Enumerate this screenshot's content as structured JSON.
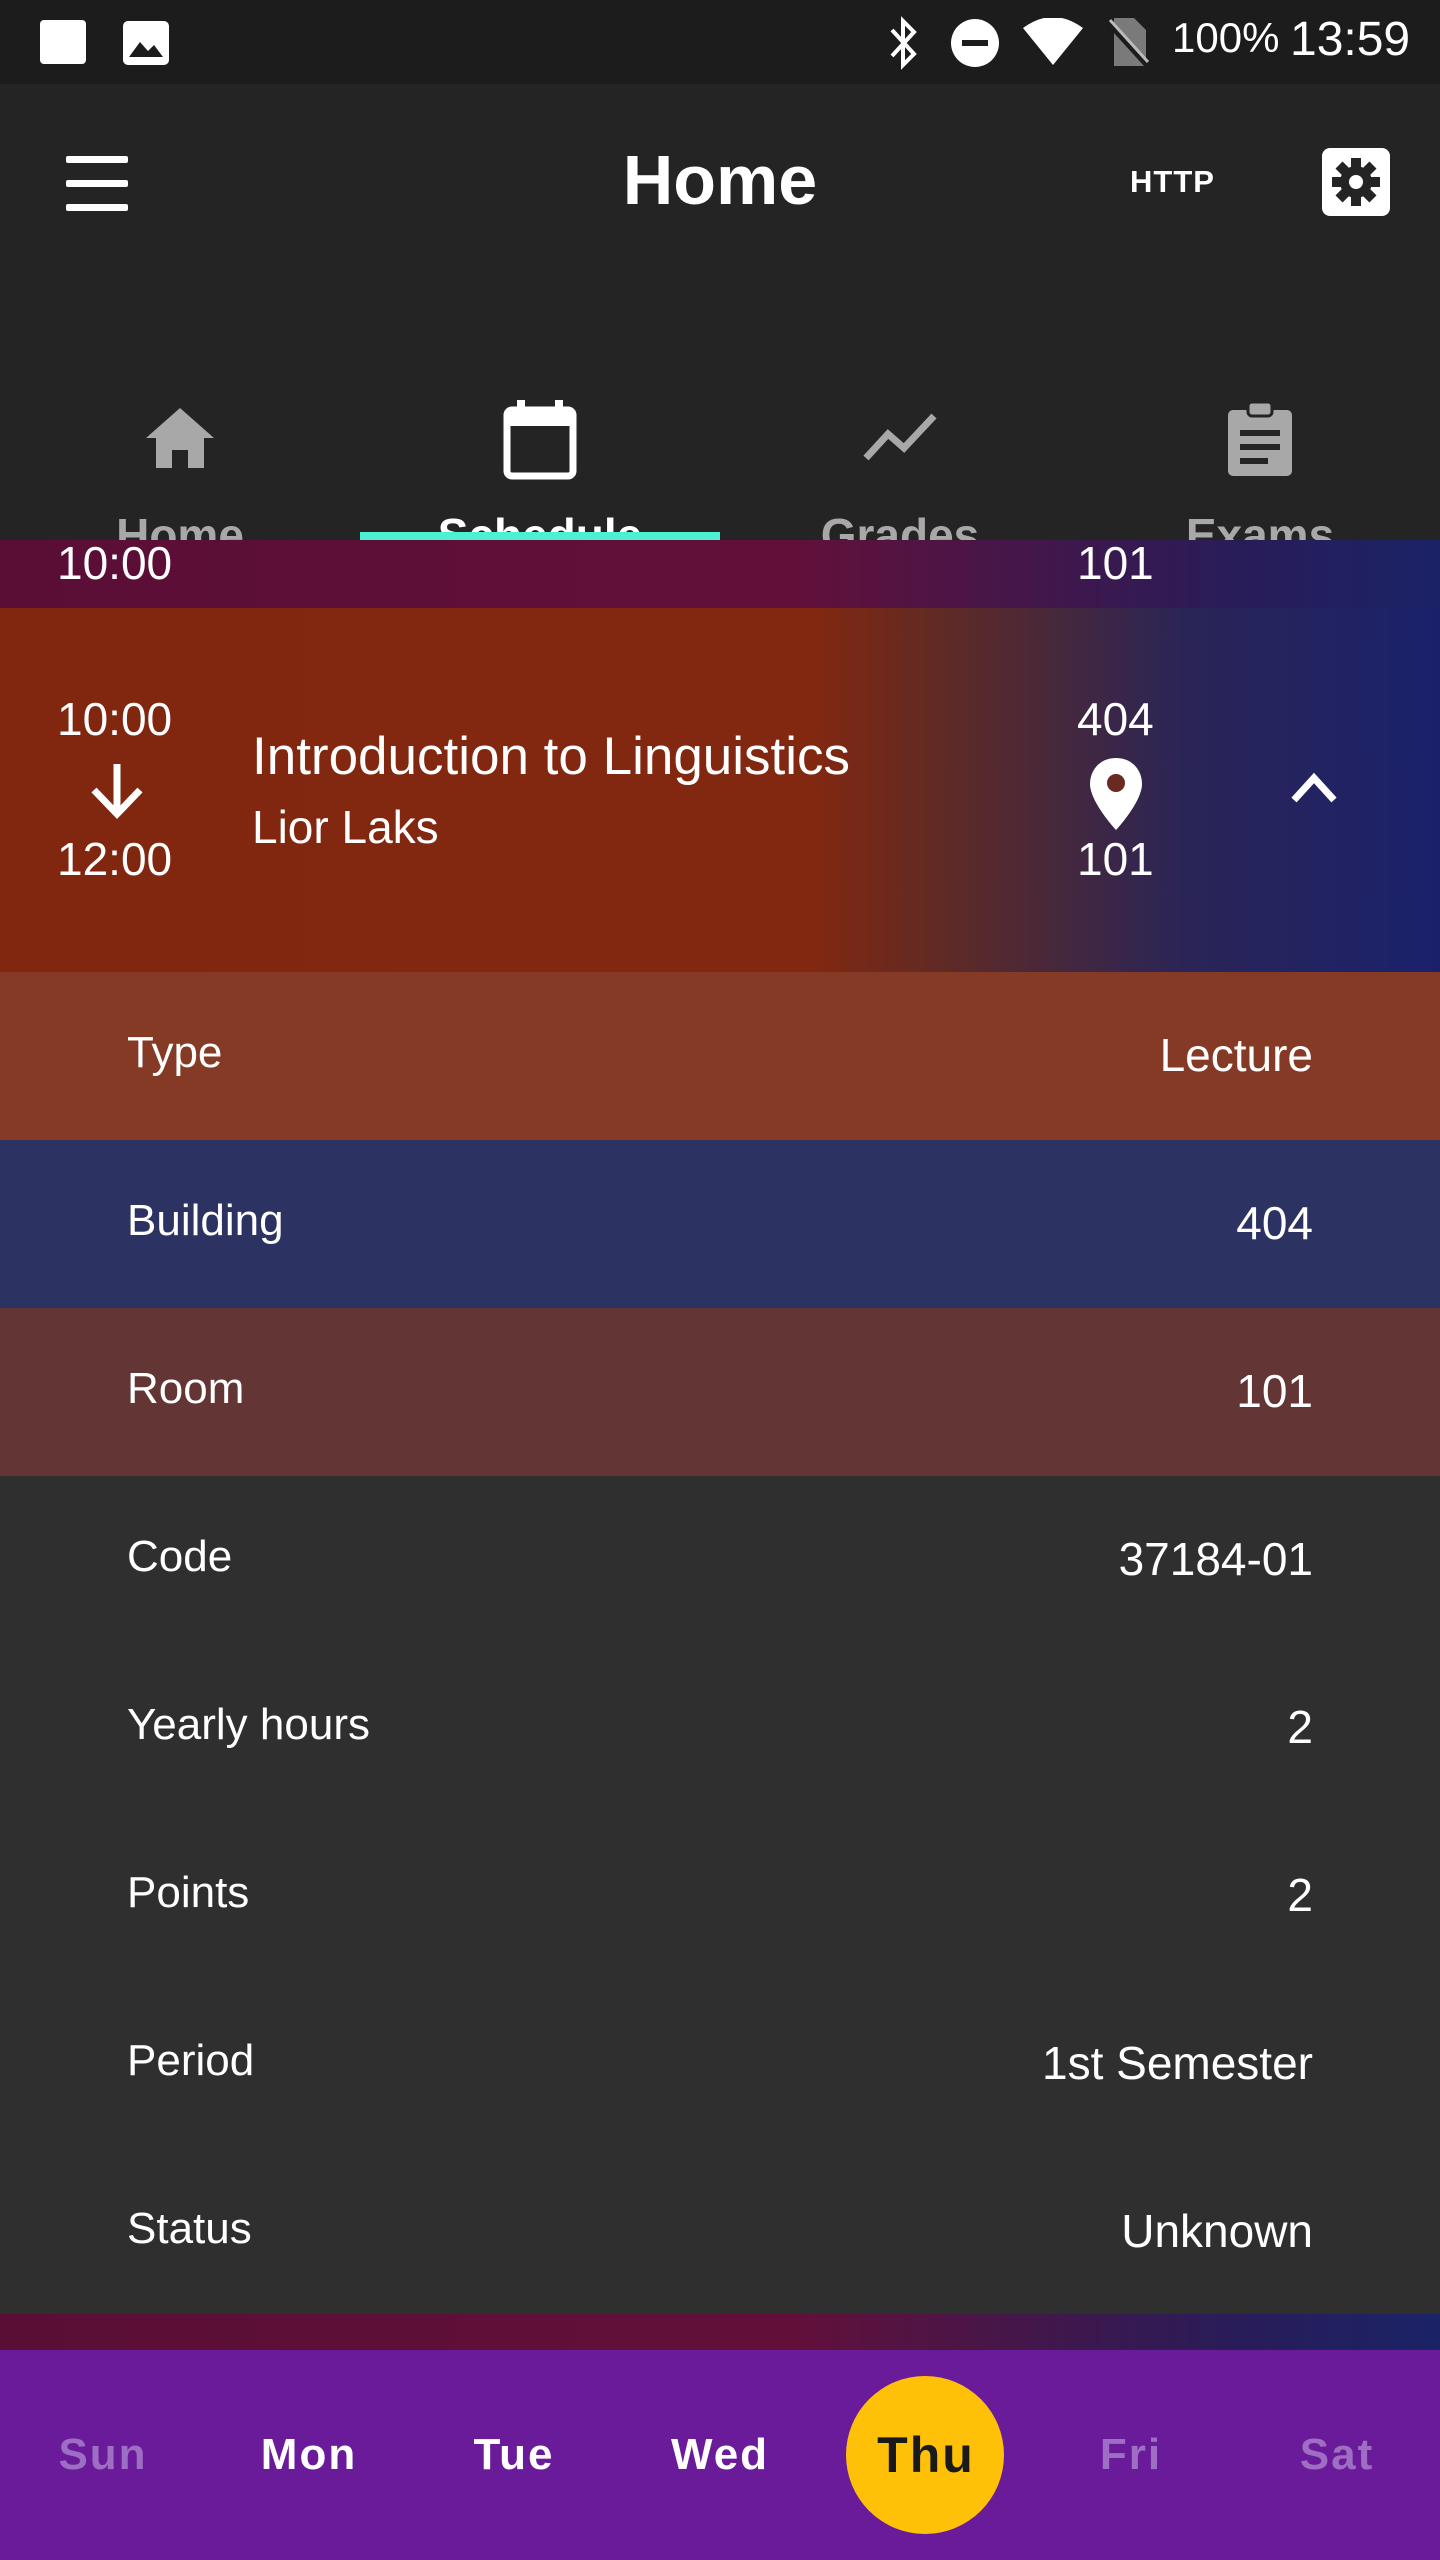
{
  "status_bar": {
    "battery": "100%",
    "time": "13:59",
    "icons": [
      "notification-square-icon",
      "image-icon",
      "bluetooth-icon",
      "do-not-disturb-icon",
      "wifi-icon",
      "no-sim-icon"
    ]
  },
  "app_bar": {
    "title": "Home",
    "http_label": "HTTP",
    "icons": [
      "menu-icon",
      "settings-icon"
    ]
  },
  "tabs": [
    {
      "label": "Home",
      "icon": "home-icon",
      "active": false
    },
    {
      "label": "Schedule",
      "icon": "calendar-icon",
      "active": true
    },
    {
      "label": "Grades",
      "icon": "trending-icon",
      "active": false
    },
    {
      "label": "Exams",
      "icon": "clipboard-icon",
      "active": false
    }
  ],
  "previous_lesson": {
    "end_time": "10:00",
    "room": "101"
  },
  "lesson": {
    "start_time": "10:00",
    "end_time": "12:00",
    "course": "Introduction to Linguistics",
    "teacher": "Lior Laks",
    "building": "404",
    "room": "101"
  },
  "details": [
    {
      "label": "Type",
      "value": "Lecture",
      "color": "#843a24"
    },
    {
      "label": "Building",
      "value": "404",
      "color": "#2c3262"
    },
    {
      "label": "Room",
      "value": "101",
      "color": "#633534"
    },
    {
      "label": "Code",
      "value": "37184-01",
      "color": "#2f2f2f"
    },
    {
      "label": "Yearly hours",
      "value": "2",
      "color": "#2f2f2f"
    },
    {
      "label": "Points",
      "value": "2",
      "color": "#2f2f2f"
    },
    {
      "label": "Period",
      "value": "1st Semester",
      "color": "#2f2f2f"
    },
    {
      "label": "Status",
      "value": "Unknown",
      "color": "#2f2f2f"
    }
  ],
  "days": [
    {
      "label": "Sun",
      "state": "muted"
    },
    {
      "label": "Mon",
      "state": "normal"
    },
    {
      "label": "Tue",
      "state": "normal"
    },
    {
      "label": "Wed",
      "state": "normal"
    },
    {
      "label": "Thu",
      "state": "selected"
    },
    {
      "label": "Fri",
      "state": "muted"
    },
    {
      "label": "Sat",
      "state": "muted"
    }
  ],
  "colors": {
    "accent_teal": "#4df0d2",
    "day_bar": "#6a1b9a",
    "selected_day": "#ffc107"
  }
}
